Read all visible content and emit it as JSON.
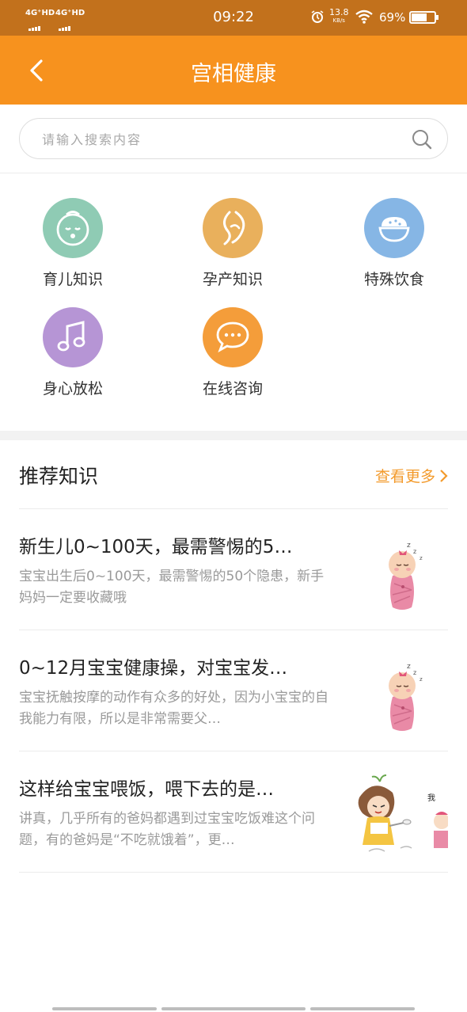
{
  "status_bar": {
    "sim1": "4G⁺HD",
    "sim2": "4G⁺HD",
    "time": "09:22",
    "speed_value": "13.8",
    "speed_unit": "KB/s",
    "battery": "69%"
  },
  "nav": {
    "title": "宫相健康"
  },
  "search": {
    "placeholder": "请输入搜索内容"
  },
  "categories": [
    {
      "label": "育儿知识",
      "icon": "baby-face-icon",
      "color": "#8fcbb4"
    },
    {
      "label": "孕产知识",
      "icon": "pregnancy-icon",
      "color": "#e9b05c"
    },
    {
      "label": "特殊饮食",
      "icon": "rice-bowl-icon",
      "color": "#86b6e5"
    },
    {
      "label": "身心放松",
      "icon": "music-note-icon",
      "color": "#b695d5"
    },
    {
      "label": "在线咨询",
      "icon": "chat-bubble-icon",
      "color": "#f49d3a"
    }
  ],
  "recommend": {
    "title": "推荐知识",
    "more": "查看更多",
    "articles": [
      {
        "title": "新生儿0~100天，最需警惕的5…",
        "desc": "宝宝出生后0~100天，最需警惕的50个隐患，新手妈妈一定要收藏哦",
        "thumb": "sleeping-baby-illustration"
      },
      {
        "title": "0~12月宝宝健康操，对宝宝发…",
        "desc": "宝宝抚触按摩的动作有众多的好处，因为小宝宝的自我能力有限，所以是非常需要父…",
        "thumb": "sleeping-baby-illustration"
      },
      {
        "title": "这样给宝宝喂饭，喂下去的是…",
        "desc": "讲真，几乎所有的爸妈都遇到过宝宝吃饭难这个问题，有的爸妈是“不吃就饿着”，更…",
        "thumb": "feeding-cartoon-illustration"
      }
    ]
  },
  "colors": {
    "status_bar": "#c2711c",
    "nav_bar": "#f7921e",
    "accent": "#f39a2b"
  }
}
